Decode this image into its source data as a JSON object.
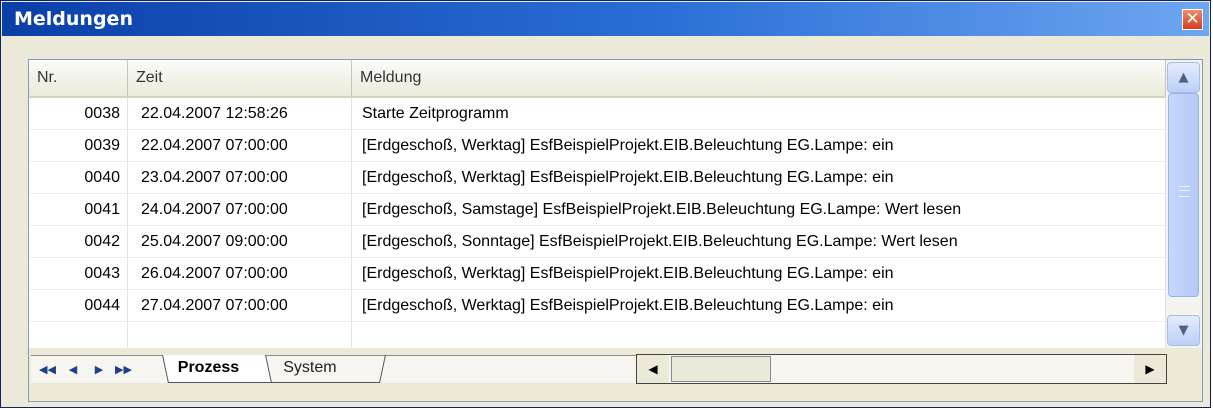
{
  "window": {
    "title": "Meldungen",
    "close_glyph": "✕"
  },
  "grid": {
    "columns": [
      "Nr.",
      "Zeit",
      "Meldung"
    ],
    "rows": [
      {
        "nr": "0038",
        "zeit": "22.04.2007 12:58:26",
        "meldung": "Starte Zeitprogramm"
      },
      {
        "nr": "0039",
        "zeit": "22.04.2007 07:00:00",
        "meldung": "[Erdgeschoß, Werktag] EsfBeispielProjekt.EIB.Beleuchtung EG.Lampe: ein"
      },
      {
        "nr": "0040",
        "zeit": "23.04.2007 07:00:00",
        "meldung": "[Erdgeschoß, Werktag] EsfBeispielProjekt.EIB.Beleuchtung EG.Lampe: ein"
      },
      {
        "nr": "0041",
        "zeit": "24.04.2007 07:00:00",
        "meldung": "[Erdgeschoß, Samstage] EsfBeispielProjekt.EIB.Beleuchtung EG.Lampe: Wert lesen"
      },
      {
        "nr": "0042",
        "zeit": "25.04.2007 09:00:00",
        "meldung": "[Erdgeschoß, Sonntage] EsfBeispielProjekt.EIB.Beleuchtung EG.Lampe: Wert lesen"
      },
      {
        "nr": "0043",
        "zeit": "26.04.2007 07:00:00",
        "meldung": "[Erdgeschoß, Werktag] EsfBeispielProjekt.EIB.Beleuchtung EG.Lampe: ein"
      },
      {
        "nr": "0044",
        "zeit": "27.04.2007 07:00:00",
        "meldung": "[Erdgeschoß, Werktag] EsfBeispielProjekt.EIB.Beleuchtung EG.Lampe: ein"
      }
    ]
  },
  "tabs": {
    "active": "Prozess",
    "inactive": "System"
  },
  "nav": {
    "first": "◀◀",
    "prev": "◀",
    "next": "▶",
    "last": "▶▶"
  },
  "scroll": {
    "up": "▲",
    "down": "▼",
    "left": "◀",
    "right": "▶"
  },
  "icons": {
    "first": "first-page-icon",
    "prev": "prev-page-icon",
    "next": "next-page-icon",
    "last": "last-page-icon"
  },
  "colors": {
    "titlebar": "#0b3fa8",
    "close": "#d2401e",
    "scroll_thumb": "#c8d7fb"
  }
}
